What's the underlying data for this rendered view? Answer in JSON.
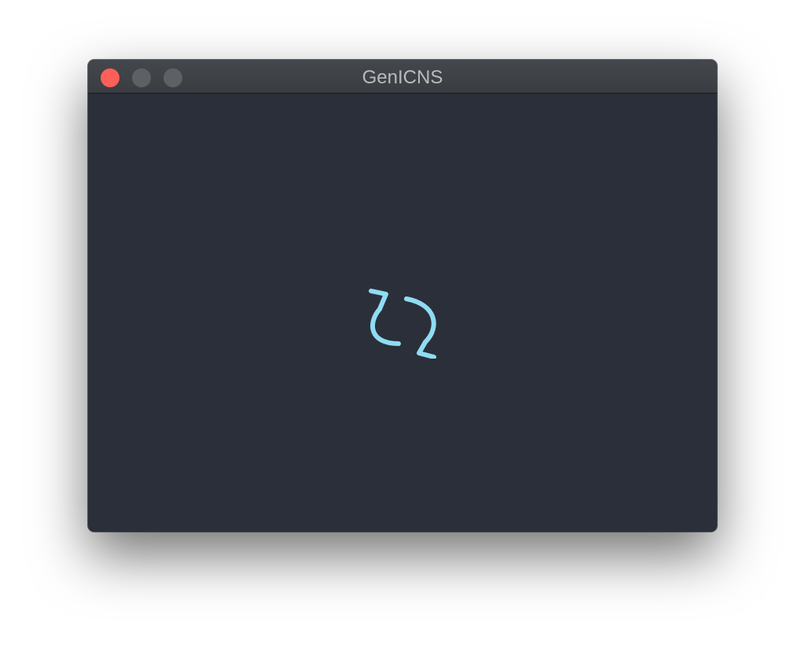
{
  "window": {
    "title": "GenICNS",
    "controls": {
      "close_color": "#fe5f57",
      "inactive_color": "#5e6064"
    }
  },
  "content": {
    "background_color": "#2b2f3a",
    "icon": "refresh-icon",
    "icon_color": "#8fdcf2"
  }
}
